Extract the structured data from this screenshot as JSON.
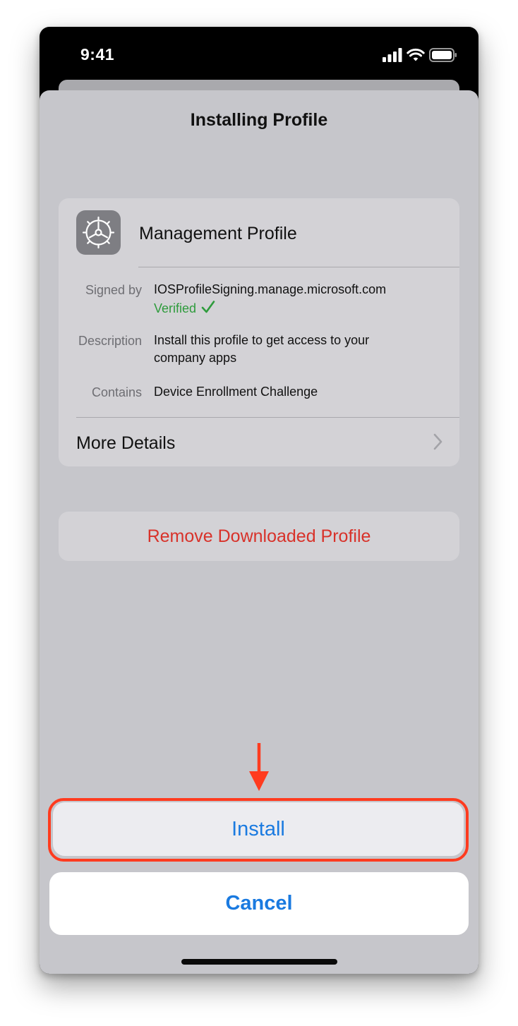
{
  "status_bar": {
    "time": "9:41",
    "icons": [
      "cellular-signal-icon",
      "wifi-icon",
      "battery-icon"
    ]
  },
  "sheet": {
    "title": "Installing Profile"
  },
  "profile": {
    "icon": "settings-gear-icon",
    "name": "Management Profile",
    "signed_by_label": "Signed by",
    "signed_by_value": "IOSProfileSigning.manage.microsoft.com",
    "verified_text": "Verified",
    "verified_icon": "checkmark-icon",
    "description_label": "Description",
    "description_value_line1": "Install this profile to get access to your",
    "description_value_line2": "company apps",
    "contains_label": "Contains",
    "contains_value": "Device Enrollment Challenge",
    "more_details_label": "More Details",
    "more_details_icon": "chevron-right-icon"
  },
  "actions": {
    "remove_label": "Remove Downloaded Profile",
    "install_label": "Install",
    "cancel_label": "Cancel"
  },
  "annotation": {
    "icon": "down-arrow-icon",
    "highlight_target": "Install"
  },
  "colors": {
    "accent_blue": "#1a7ae0",
    "destructive_red": "#d8322a",
    "verified_green": "#2e9b3c",
    "annotation_red": "#ff3b1f"
  }
}
